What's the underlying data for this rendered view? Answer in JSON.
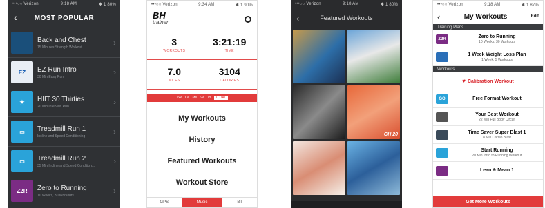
{
  "phone1": {
    "status": {
      "carrier": "•••○○ Verizon",
      "time": "9:18 AM",
      "battery": "✱ 1 80%"
    },
    "title": "MOST POPULAR",
    "items": [
      {
        "title": "Back and Chest",
        "sub": "15 Minutes Strength Workout",
        "icon": "dumbbell-thumb",
        "thumb": "",
        "color": "#1a4f7a"
      },
      {
        "title": "EZ Run Intro",
        "sub": "30 Min Easy Run",
        "icon": "ez-logo",
        "thumb": "EZ",
        "color": "#e9eef5"
      },
      {
        "title": "HIIT 30 Thirties",
        "sub": "20 Min Intervals Run",
        "icon": "star-icon",
        "thumb": "★",
        "color": "#2aa3d9"
      },
      {
        "title": "Treadmill Run 1",
        "sub": "Incline and Speed Conditioning",
        "icon": "treadmill-icon",
        "thumb": "▭",
        "color": "#2aa3d9"
      },
      {
        "title": "Treadmill Run 2",
        "sub": "35 Min Incline and Speed Condition...",
        "icon": "treadmill-icon",
        "thumb": "▭",
        "color": "#2aa3d9"
      },
      {
        "title": "Zero to Running",
        "sub": "10 Weeks, 30 Workouts",
        "icon": "z2r-logo",
        "thumb": "Z2R",
        "color": "#7b2c84"
      }
    ]
  },
  "phone2": {
    "status": {
      "carrier": "•••○○ Verizon",
      "time": "9:34 AM",
      "battery": "✱ 1 90%"
    },
    "brand": "BH",
    "brand_sub": "trainer",
    "stats": [
      {
        "value": "3",
        "label": "WORKOUTS"
      },
      {
        "value": "3:21:19",
        "label": "TIME"
      },
      {
        "value": "7.0",
        "label": "MILES"
      },
      {
        "value": "3104",
        "label": "CALORIES"
      }
    ],
    "periods": [
      "1W",
      "1M",
      "3M",
      "6M",
      "1Y",
      "TOTAL"
    ],
    "menu": [
      "My Workouts",
      "History",
      "Featured Workouts",
      "Workout Store"
    ],
    "tabs": {
      "gps": "GPS",
      "music": "Music",
      "other": "BT"
    }
  },
  "phone3": {
    "status": {
      "carrier": "•••○○ Verizon",
      "time": "9:18 AM",
      "battery": "✱ 1 80%"
    },
    "title": "Featured Workouts",
    "tiles": [
      "",
      "",
      "",
      "GH 20",
      "",
      ""
    ]
  },
  "phone4": {
    "status": {
      "carrier": "•••○○ Verizon",
      "time": "9:18 AM",
      "battery": "✱ 1 87%"
    },
    "title": "My Workouts",
    "edit": "Edit",
    "section1": "Training Plans",
    "plans": [
      {
        "name": "Zero to Running",
        "sub": "10 Weeks, 30 Workouts",
        "thumb": "Z2R",
        "color": "#7b2c84"
      },
      {
        "name": "1 Week Weight Loss Plan",
        "sub": "1 Week, 5 Workouts",
        "thumb": "",
        "color": "#2b6fb8"
      }
    ],
    "section2": "Workouts",
    "workouts": [
      {
        "name": "Calibration Workout",
        "sub": "",
        "thumb": "",
        "color": "",
        "calibration": true
      },
      {
        "name": "Free Format Workout",
        "sub": "",
        "thumb": "GO",
        "color": "#2aa3d9"
      },
      {
        "name": "Your Best Workout",
        "sub": "22 Min Full Body Circuit",
        "thumb": "",
        "color": "#555"
      },
      {
        "name": "Time Saver Super Blast 1",
        "sub": "8 Min Cardio Blast",
        "thumb": "",
        "color": "#3a4a5a"
      },
      {
        "name": "Start Running",
        "sub": "20 Min Intro to Running Workout",
        "thumb": "",
        "color": "#2aa3d9"
      },
      {
        "name": "Lean & Mean 1",
        "sub": "",
        "thumb": "",
        "color": "#7b2c84"
      }
    ],
    "cta": "Get More Workouts"
  }
}
